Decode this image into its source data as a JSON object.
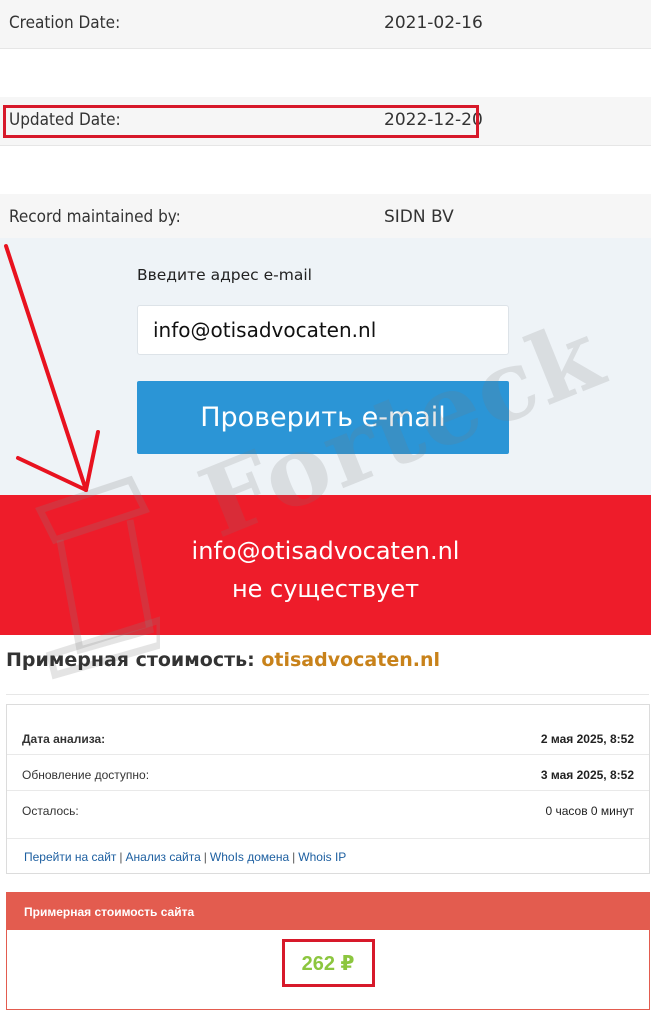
{
  "whois": {
    "creation_label": "Creation Date:",
    "creation_value": "2021-02-16",
    "updated_label": "Updated Date:",
    "updated_value": "2022-12-20",
    "record_label": "Record maintained by:",
    "record_value": "SIDN BV"
  },
  "email_check": {
    "label": "Введите адрес e-mail",
    "input_value": "info@otisadvocaten.nl",
    "button_label": "Проверить e-mail"
  },
  "result": {
    "email": "info@otisadvocaten.nl",
    "status": "не существует"
  },
  "watermark": {
    "text": "Forteck"
  },
  "estimate": {
    "heading": "Примерная стоимость:",
    "domain": "otisadvocaten.nl",
    "rows": [
      {
        "label": "Дата анализа:",
        "value": "2 мая 2025, 8:52"
      },
      {
        "label": "Обновление доступно:",
        "value": "3 мая 2025, 8:52"
      },
      {
        "label": "Осталось:",
        "value": "0 часов 0 минут"
      }
    ],
    "links": [
      "Перейти на сайт",
      "Анализ сайта",
      "WhoIs домена",
      "Whois IP"
    ],
    "cost_header": "Примерная стоимость сайта",
    "cost_value": "262 ₽"
  },
  "colors": {
    "banner_red": "#ee1c2a",
    "button_blue": "#2b95d6",
    "domain_orange": "#c8821a",
    "cost_green": "#8cc63f",
    "cost_header": "#e35c4f"
  }
}
